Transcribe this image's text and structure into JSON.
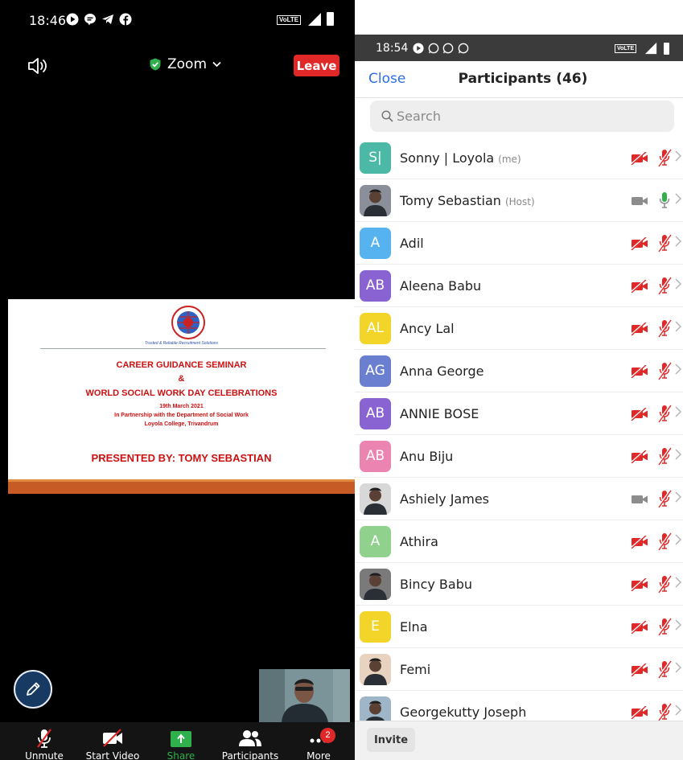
{
  "colors": {
    "danger": "#e02828",
    "accent_blue": "#2d6ee6",
    "active_green": "#2fb04c",
    "slide_red": "#cc1111"
  },
  "meeting": {
    "status_time": "18:46",
    "network_badge": "VoLTE",
    "title": "Zoom",
    "leave_label": "Leave",
    "slide": {
      "tagline": "Trusted & Reliable Recruitment Solutions",
      "heading1": "CAREER GUIDANCE SEMINAR",
      "ampersand": "&",
      "heading2": "WORLD SOCIAL WORK DAY CELEBRATIONS",
      "date": "19th March 2021",
      "partner": "In Partnership with the Department of Social Work",
      "college": "Loyola College, Trivandrum",
      "presenter": "PRESENTED BY: TOMY SEBASTIAN"
    },
    "toolbar": {
      "unmute": "Unmute",
      "start_video": "Start Video",
      "share": "Share",
      "participants": "Participants",
      "more": "More",
      "more_badge": "2"
    }
  },
  "participants_panel": {
    "status_time": "18:54",
    "network_badge": "VoLTE",
    "close_label": "Close",
    "title": "Participants (46)",
    "search_placeholder": "Search",
    "invite_label": "Invite",
    "participants": [
      {
        "initials": "S|",
        "name": "Sonny | Loyola",
        "role": "(me)",
        "avatar_color": "#4bb9a6",
        "photo": false,
        "video_on": false,
        "mic_on": false
      },
      {
        "initials": "",
        "name": "Tomy Sebastian",
        "role": "(Host)",
        "avatar_color": "#8a8f99",
        "photo": true,
        "video_on": true,
        "mic_on": true
      },
      {
        "initials": "A",
        "name": "Adil",
        "role": "",
        "avatar_color": "#56b3f0",
        "photo": false,
        "video_on": false,
        "mic_on": false
      },
      {
        "initials": "AB",
        "name": "Aleena Babu",
        "role": "",
        "avatar_color": "#8a63d2",
        "photo": false,
        "video_on": false,
        "mic_on": false
      },
      {
        "initials": "AL",
        "name": "Ancy Lal",
        "role": "",
        "avatar_color": "#f3d52a",
        "photo": false,
        "video_on": false,
        "mic_on": false
      },
      {
        "initials": "AG",
        "name": "Anna George",
        "role": "",
        "avatar_color": "#6b7fd0",
        "photo": false,
        "video_on": false,
        "mic_on": false
      },
      {
        "initials": "AB",
        "name": "ANNIE BOSE",
        "role": "",
        "avatar_color": "#8a63d2",
        "photo": false,
        "video_on": false,
        "mic_on": false
      },
      {
        "initials": "AB",
        "name": "Anu Biju",
        "role": "",
        "avatar_color": "#ec84b2",
        "photo": false,
        "video_on": false,
        "mic_on": false
      },
      {
        "initials": "",
        "name": "Ashiely James",
        "role": "",
        "avatar_color": "#d8d8d8",
        "photo": true,
        "video_on": true,
        "mic_on": false
      },
      {
        "initials": "A",
        "name": "Athira",
        "role": "",
        "avatar_color": "#8fd18d",
        "photo": false,
        "video_on": false,
        "mic_on": false
      },
      {
        "initials": "",
        "name": "Bincy Babu",
        "role": "",
        "avatar_color": "#7a7a7a",
        "photo": true,
        "video_on": false,
        "mic_on": false
      },
      {
        "initials": "E",
        "name": "Elna",
        "role": "",
        "avatar_color": "#f3d52a",
        "photo": false,
        "video_on": false,
        "mic_on": false
      },
      {
        "initials": "",
        "name": "Femi",
        "role": "",
        "avatar_color": "#e8d3c0",
        "photo": true,
        "video_on": false,
        "mic_on": false
      },
      {
        "initials": "",
        "name": "Georgekutty Joseph",
        "role": "",
        "avatar_color": "#9eb6c8",
        "photo": true,
        "video_on": false,
        "mic_on": false
      }
    ]
  }
}
